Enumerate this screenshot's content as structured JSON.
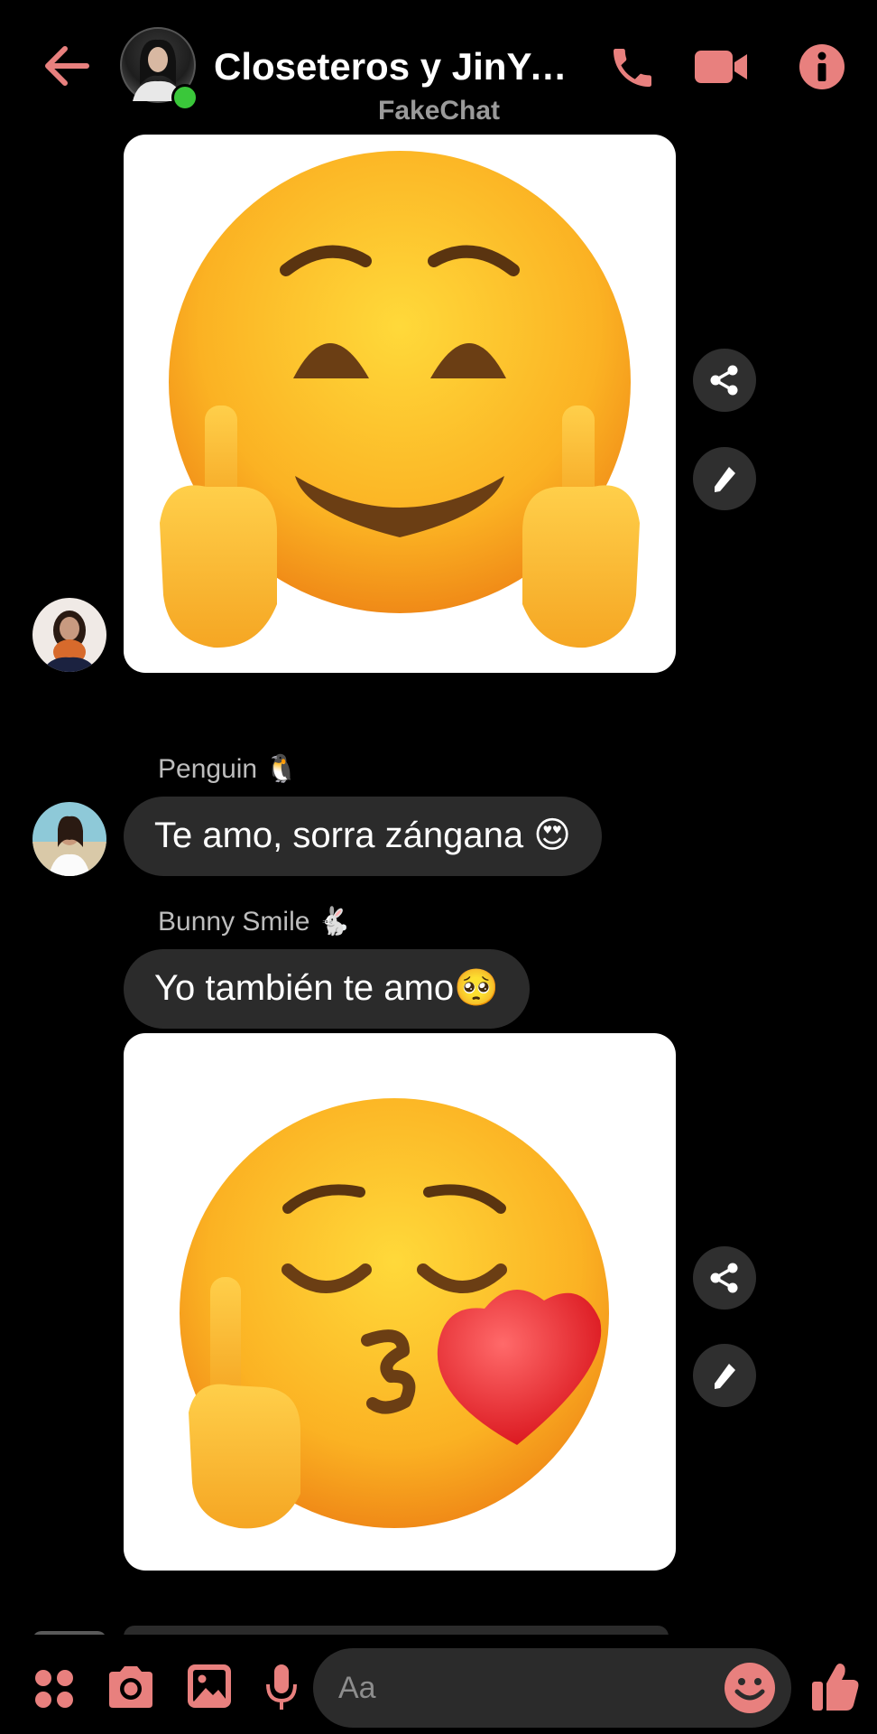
{
  "header": {
    "title": "Closeteros y JinYo…",
    "subtitle": "FakeChat",
    "back_icon": "arrow-left-icon",
    "call_icon": "phone-icon",
    "video_icon": "video-camera-icon",
    "info_icon": "info-icon"
  },
  "messages": [
    {
      "type": "image",
      "content": "emoji: smiling face with middle fingers"
    },
    {
      "type": "text",
      "sender": "Penguin 🐧",
      "text": "Te amo, sorra zángana 😍"
    },
    {
      "type": "text",
      "sender": "Bunny Smile 🐇",
      "text": "Yo también te amo🥺"
    },
    {
      "type": "image",
      "content": "emoji: kissing face with middle finger and heart"
    }
  ],
  "composer": {
    "placeholder": "Aa",
    "tools": [
      "apps-icon",
      "camera-icon",
      "gallery-icon",
      "microphone-icon"
    ],
    "emoji_icon": "smiley-icon",
    "like_icon": "thumbs-up-icon"
  },
  "colors": {
    "accent": "#e8807e",
    "background": "#000000",
    "bubble": "#2b2b2b",
    "online": "#3ac73a"
  }
}
